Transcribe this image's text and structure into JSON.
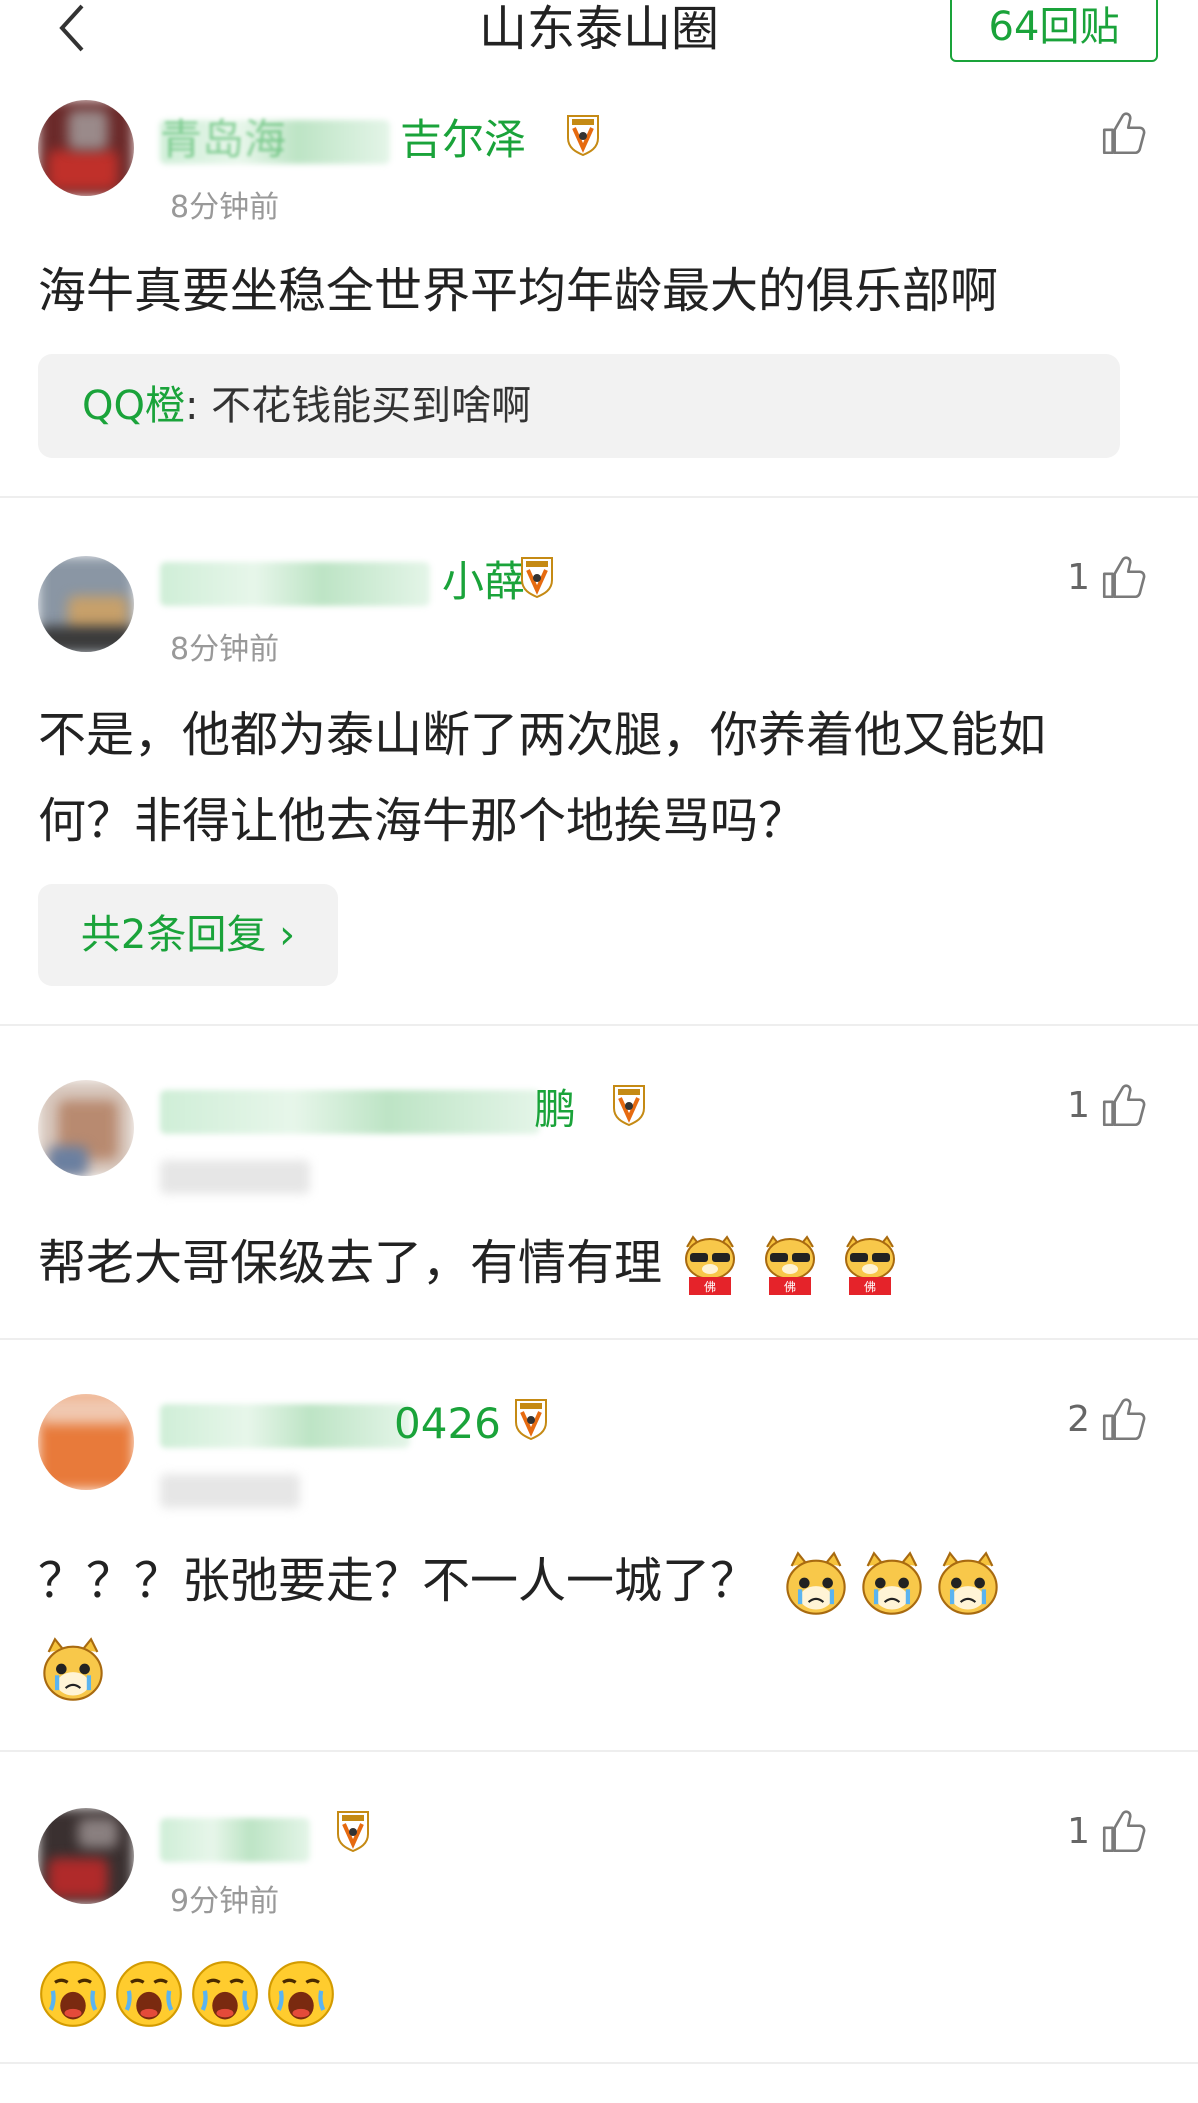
{
  "header": {
    "title": "山东泰山圈",
    "reply_count": "64回贴"
  },
  "comments": [
    {
      "user_visible": "青岛海",
      "user_visible_tail": "吉尔泽",
      "time": "8分钟前",
      "likes": "",
      "text": "海牛真要坐稳全世界平均年龄最大的俱乐部啊",
      "reply": {
        "name": "QQ橙",
        "text": ": 不花钱能买到啥啊"
      }
    },
    {
      "user_visible_tail": "小薛",
      "time": "8分钟前",
      "likes": "1",
      "text": "不是，他都为泰山断了两次腿，你养着他又能如何？非得让他去海牛那个地挨骂吗？",
      "more_replies": "共2条回复"
    },
    {
      "user_visible_tail": "鹏",
      "time": "",
      "likes": "1",
      "text": "帮老大哥保级去了，有情有理"
    },
    {
      "user_visible_tail": "0426",
      "time": "",
      "likes": "2",
      "text": "？？？张弛要走？不一人一城了？"
    },
    {
      "user_visible_tail": "",
      "time": "9分钟前",
      "likes": "1",
      "text": ""
    }
  ],
  "icons": {
    "back": "chevron-left-icon",
    "like": "thumbs-up-icon",
    "badge": "team-crest-icon",
    "emoji_cool": "dog-sunglasses-emoji",
    "emoji_cry": "dog-crying-emoji",
    "emoji_sad": "crying-face-emoji"
  },
  "colors": {
    "accent": "#1aa33a",
    "muted": "#999999",
    "reply_bg": "#f2f2f2"
  }
}
